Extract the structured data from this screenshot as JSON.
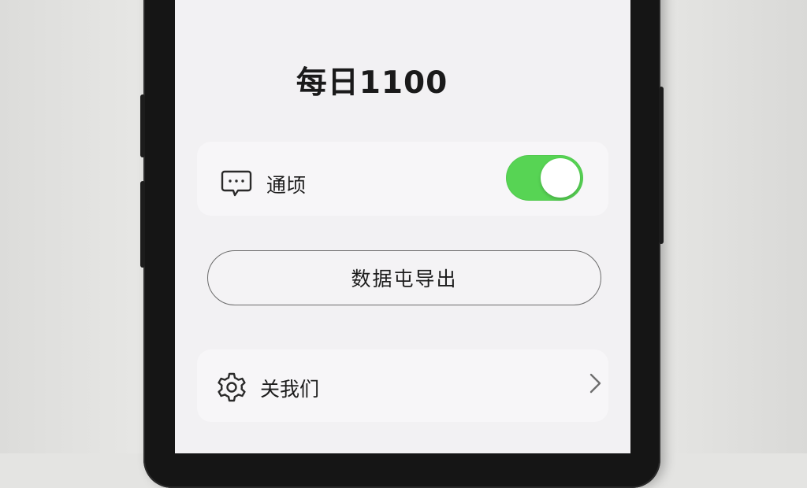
{
  "app": {
    "title": "每日1100"
  },
  "settings": {
    "notify": {
      "label": "通顷",
      "icon": "chat-bubble-icon",
      "toggle_on": true
    },
    "export_button": {
      "label": "数据屯导出"
    },
    "about": {
      "label": "关我们",
      "icon": "gear-icon",
      "chevron_icon": "chevron-right-icon"
    }
  },
  "colors": {
    "toggle_on": "#57d454",
    "screen_bg": "#f2f1f3",
    "card_bg": "#f7f6f8",
    "text": "#1c1c1c"
  }
}
